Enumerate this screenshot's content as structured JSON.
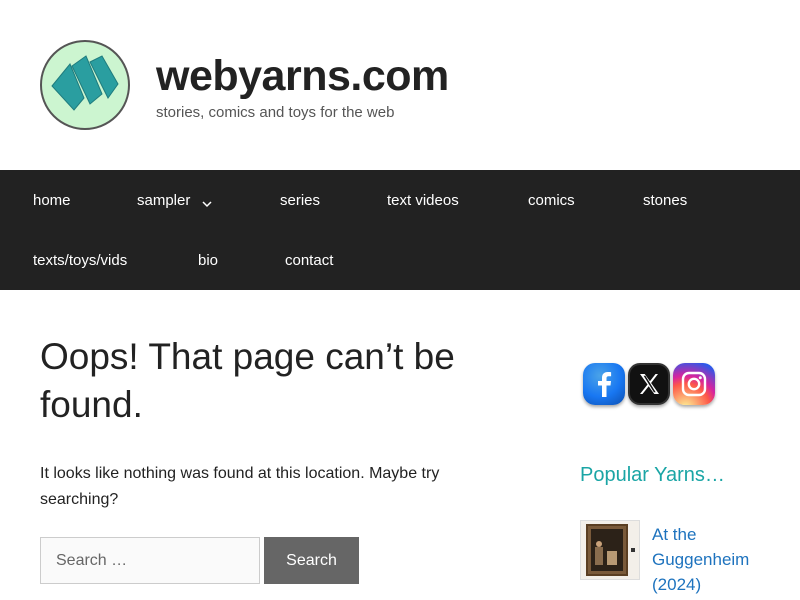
{
  "site": {
    "title": "webyarns.com",
    "tagline": "stories, comics and toys for the web",
    "logo_icon": "webyarns-logo-icon"
  },
  "nav": {
    "items": [
      {
        "label": "home"
      },
      {
        "label": "sampler",
        "has_dropdown": true
      },
      {
        "label": "series"
      },
      {
        "label": "text videos"
      },
      {
        "label": "comics"
      },
      {
        "label": "stones"
      },
      {
        "label": "texts/toys/vids"
      },
      {
        "label": "bio"
      },
      {
        "label": "contact"
      }
    ]
  },
  "main": {
    "title": "Oops! That page can’t be found.",
    "message": "It looks like nothing was found at this location. Maybe try searching?",
    "search": {
      "placeholder": "Search …",
      "button_label": "Search"
    }
  },
  "sidebar": {
    "social": [
      {
        "icon": "facebook-icon"
      },
      {
        "icon": "x-twitter-icon"
      },
      {
        "icon": "instagram-icon"
      }
    ],
    "popular_title": "Popular Yarns…",
    "popular_items": [
      {
        "label": "At the Guggenheim (2024)"
      }
    ]
  },
  "colors": {
    "nav_bg": "#222222",
    "accent": "#1aa5a5",
    "link": "#1e73be",
    "logo_bg": "#ccf5d0",
    "logo_mark": "#2a9ea0",
    "button_bg": "#666666"
  }
}
